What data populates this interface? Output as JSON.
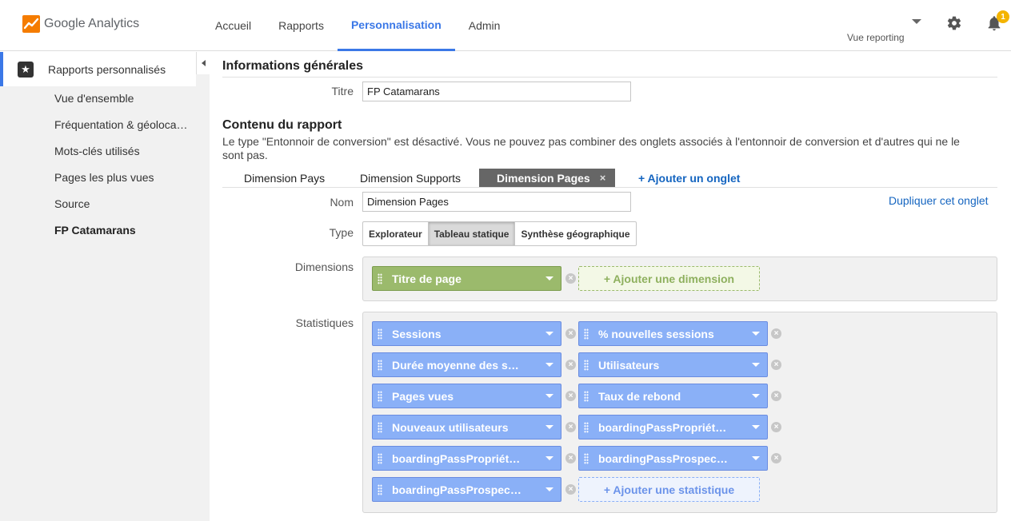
{
  "header": {
    "logo_text": "Google Analytics",
    "nav": [
      "Accueil",
      "Rapports",
      "Personnalisation",
      "Admin"
    ],
    "active_nav": "Personnalisation",
    "view_label": "Vue reporting",
    "notification_count": "1"
  },
  "sidebar": {
    "section_title": "Rapports personnalisés",
    "items": [
      "Vue d'ensemble",
      "Fréquentation & géoloca…",
      "Mots-clés utilisés",
      "Pages les plus vues",
      "Source",
      "FP Catamarans"
    ],
    "selected_item": "FP Catamarans"
  },
  "general": {
    "title": "Informations générales",
    "titre_label": "Titre",
    "titre_value": "FP Catamarans"
  },
  "content": {
    "title": "Contenu du rapport",
    "note": "Le type \"Entonnoir de conversion\" est désactivé. Vous ne pouvez pas combiner des onglets associés à l'entonnoir de conversion et d'autres qui ne le sont pas.",
    "tabs": [
      "Dimension Pays",
      "Dimension Supports",
      "Dimension Pages"
    ],
    "active_tab": "Dimension Pages",
    "tab_close": "×",
    "add_tab": "+ Ajouter un onglet",
    "duplicate": "Dupliquer cet onglet",
    "nom_label": "Nom",
    "nom_value": "Dimension Pages",
    "type_label": "Type",
    "types": [
      "Explorateur",
      "Tableau statique",
      "Synthèse géographique"
    ],
    "active_type": "Tableau statique",
    "dimensions_label": "Dimensions",
    "dimensions": [
      "Titre de page"
    ],
    "add_dimension": "+ Ajouter une dimension",
    "stats_label": "Statistiques",
    "stats": [
      "Sessions",
      "% nouvelles sessions",
      "Durée moyenne des s…",
      "Utilisateurs",
      "Pages vues",
      "Taux de rebond",
      "Nouveaux utilisateurs",
      "boardingPassPropriét…",
      "boardingPassPropriét…",
      "boardingPassProspec…",
      "boardingPassProspec…"
    ],
    "add_stat": "+ Ajouter une statistique",
    "remove_symbol": "×"
  },
  "colors": {
    "accent": "#3b78e7",
    "dimension_chip": "#9bba6c",
    "metric_chip": "#8ab0f7",
    "active_tab_bg": "#666666"
  }
}
